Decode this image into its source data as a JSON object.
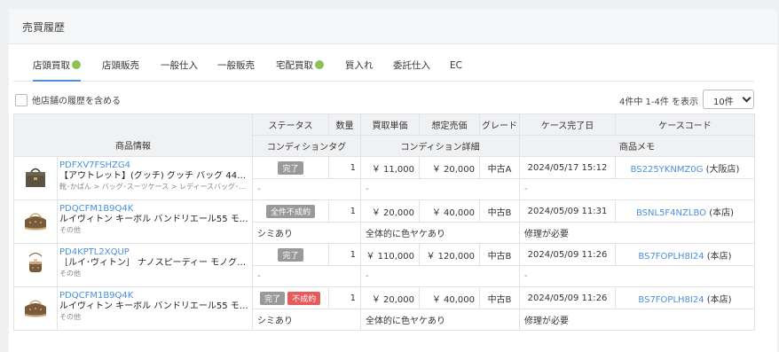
{
  "section_title": "売買履歴",
  "tabs": [
    {
      "label": "店頭買取",
      "dot": true,
      "active": true
    },
    {
      "label": "店頭販売",
      "dot": false,
      "active": false
    },
    {
      "label": "一般仕入",
      "dot": false,
      "active": false
    },
    {
      "label": "一般販売",
      "dot": false,
      "active": false
    },
    {
      "label": "宅配買取",
      "dot": true,
      "active": false
    },
    {
      "label": "質入れ",
      "dot": false,
      "active": false
    },
    {
      "label": "委託仕入",
      "dot": false,
      "active": false
    },
    {
      "label": "EC",
      "dot": false,
      "active": false
    }
  ],
  "include_other_stores_label": "他店舗の履歴を含める",
  "count_text": "4件中 1-4件 を表示",
  "page_size": "10件",
  "headers": {
    "product_info": "商品情報",
    "status": "ステータス",
    "qty": "数量",
    "buy_price": "買取単価",
    "expected_price": "想定売価",
    "grade": "グレード",
    "case_done": "ケース完了日",
    "case_code": "ケースコード",
    "condition_tag": "コンディションタグ",
    "condition_detail": "コンディション詳細",
    "product_memo": "商品メモ"
  },
  "rows": [
    {
      "code": "PDFXV7FSHZG4",
      "name": "【アウトレット】(グッチ) グッチ バッグ 449169-98865…",
      "category": "靴･かばん > バッグ･スーツケース > レディースバッグ･財布 > バッグ…",
      "badges": [
        {
          "text": "完了",
          "color": "gray"
        }
      ],
      "qty": "1",
      "buy_price": "￥ 11,000",
      "expected_price": "￥ 20,000",
      "grade": "中古A",
      "case_done": "2024/05/17 15:12",
      "case_code": "BS225YKNMZ0G",
      "store": "(大阪店)",
      "condition_tag": "-",
      "condition_detail": "-",
      "memo": "-",
      "thumb": "brown-tote"
    },
    {
      "code": "PDQCFM1B9Q4K",
      "name": "ルイヴィトン キーポル バンドリエール55 モノグラム M…",
      "category": "その他",
      "badges": [
        {
          "text": "全件不成約",
          "color": "gray"
        }
      ],
      "qty": "1",
      "buy_price": "￥ 20,000",
      "expected_price": "￥ 40,000",
      "grade": "中古B",
      "case_done": "2024/05/09 11:31",
      "case_code": "BSNL5F4NZLBO",
      "store": "(本店)",
      "condition_tag": "シミあり",
      "condition_detail": "全体的に色ヤケあり",
      "memo": "修理が必要",
      "thumb": "monogram-duffle"
    },
    {
      "code": "PD4KPTL2XQUP",
      "name": "［ルイ･ヴィトン］ ナノスピーディー モノグラム ミニバ…",
      "category": "その他",
      "badges": [
        {
          "text": "完了",
          "color": "gray"
        }
      ],
      "qty": "1",
      "buy_price": "￥ 110,000",
      "expected_price": "￥ 120,000",
      "grade": "中古B",
      "case_done": "2024/05/09 11:26",
      "case_code": "BS7FOPLH8I24",
      "store": "(本店)",
      "condition_tag": "-",
      "condition_detail": "-",
      "memo": "-",
      "thumb": "nano-speedy"
    },
    {
      "code": "PDQCFM1B9Q4K",
      "name": "ルイヴィトン キーポル バンドリエール55 モノグラム M…",
      "category": "その他",
      "badges": [
        {
          "text": "完了",
          "color": "gray"
        },
        {
          "text": "不成約",
          "color": "red"
        }
      ],
      "qty": "1",
      "buy_price": "￥ 20,000",
      "expected_price": "￥ 40,000",
      "grade": "中古B",
      "case_done": "2024/05/09 11:26",
      "case_code": "BS7FOPLH8I24",
      "store": "(本店)",
      "condition_tag": "シミあり",
      "condition_detail": "全体的に色ヤケあり",
      "memo": "修理が必要",
      "thumb": "monogram-duffle"
    }
  ]
}
